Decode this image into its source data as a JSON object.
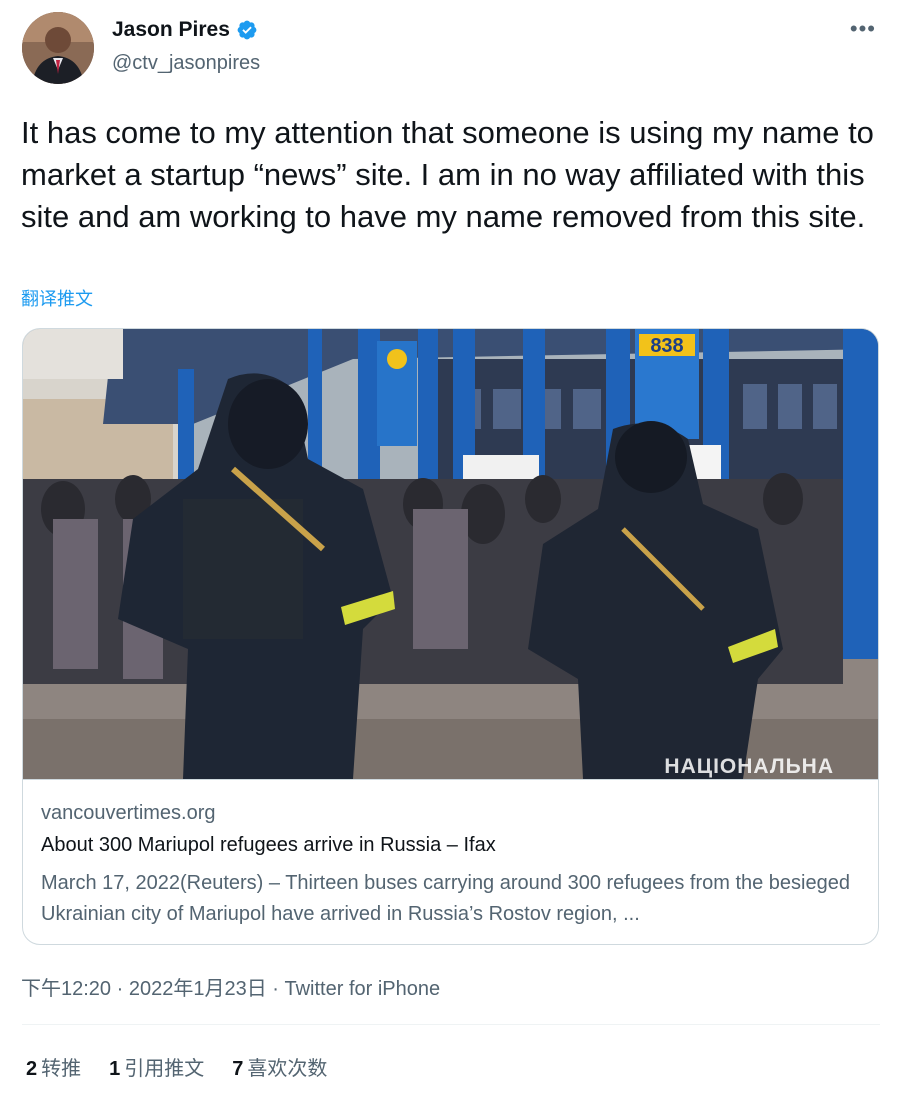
{
  "author": {
    "display_name": "Jason Pires",
    "handle": "@ctv_jasonpires",
    "verified": true
  },
  "more_icon": "•••",
  "tweet_text": "It has come to my attention that someone is using my name to market a startup “news” site. I am in no way affiliated with this site and am working to have my name removed from this site.",
  "translate_label": "翻译推文",
  "card": {
    "image_watermark": "НАЦІОНАЛЬНА",
    "sign_number": "838",
    "domain": "vancouvertimes.org",
    "title": "About 300 Mariupol refugees arrive in Russia – Ifax",
    "description": "March 17, 2022(Reuters) – Thirteen buses carrying around 300 refugees from the besieged Ukrainian city of Mariupol have arrived in Russia’s Rostov region, ..."
  },
  "meta": {
    "time": "下午12:20",
    "separator1": " · ",
    "date": "2022年1月23日",
    "separator2": " · ",
    "source": "Twitter for iPhone"
  },
  "stats": {
    "retweets_count": "2",
    "retweets_label": "转推",
    "quotes_count": "1",
    "quotes_label": "引用推文",
    "likes_count": "7",
    "likes_label": "喜欢次数"
  },
  "colors": {
    "accent": "#1d9bf0",
    "secondary_text": "#536471",
    "border": "#cfd9de"
  }
}
